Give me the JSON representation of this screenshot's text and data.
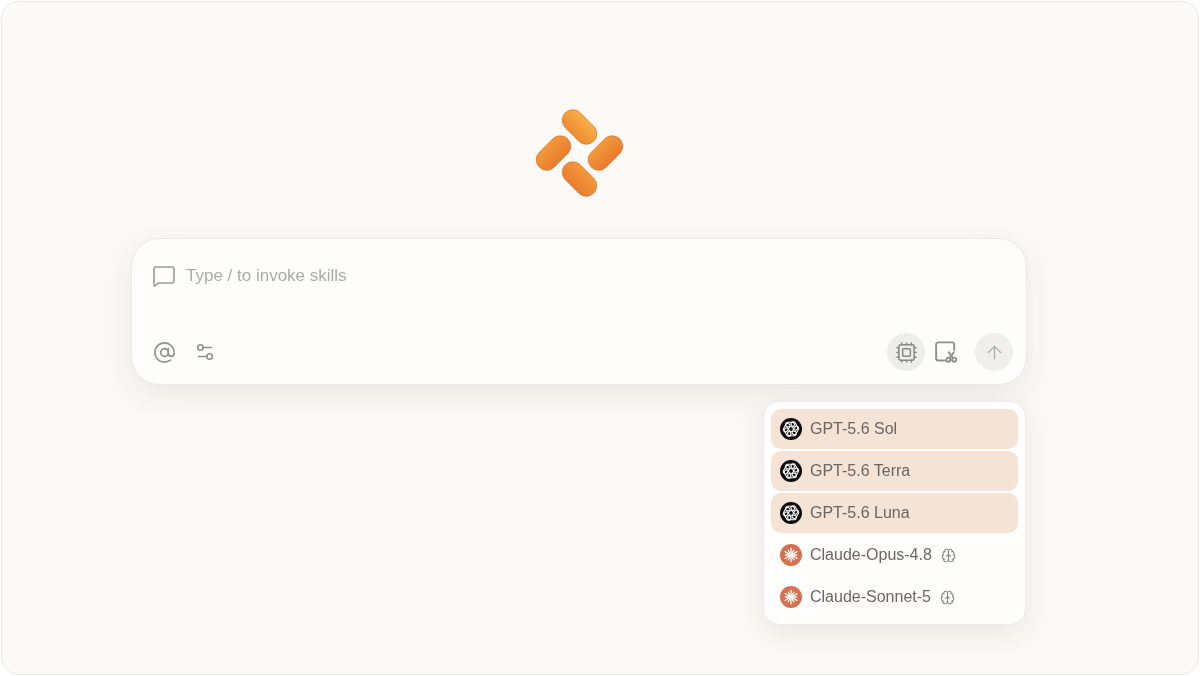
{
  "composer": {
    "placeholder": "Type / to invoke skills",
    "model_button": {
      "selected": true
    },
    "send_button": {
      "disabled": true
    }
  },
  "model_menu": {
    "items": [
      {
        "label": "GPT-5.6 Sol",
        "kind": "openai",
        "selected": true,
        "thinking": false
      },
      {
        "label": "GPT-5.6 Terra",
        "kind": "openai",
        "selected": true,
        "thinking": false
      },
      {
        "label": "GPT-5.6 Luna",
        "kind": "openai",
        "selected": true,
        "thinking": false
      },
      {
        "label": "Claude-Opus-4.8",
        "kind": "anthropic",
        "selected": false,
        "thinking": true
      },
      {
        "label": "Claude-Sonnet-5",
        "kind": "anthropic",
        "selected": false,
        "thinking": true
      }
    ]
  }
}
